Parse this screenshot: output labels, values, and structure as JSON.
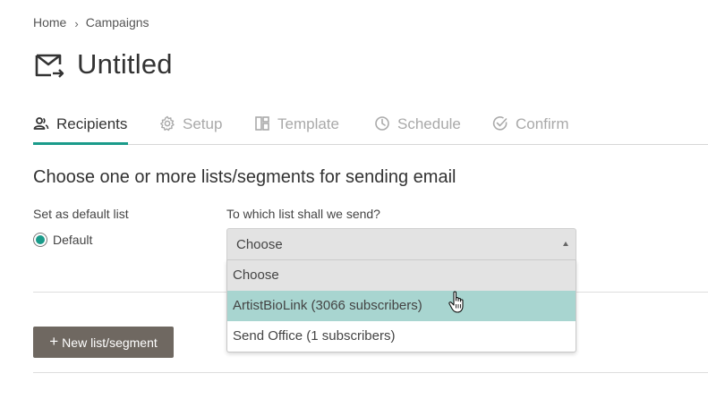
{
  "breadcrumb": {
    "home": "Home",
    "separator": "›",
    "current": "Campaigns"
  },
  "page": {
    "title": "Untitled",
    "title_icon": "mail-send-icon"
  },
  "tabs": [
    {
      "label": "Recipients",
      "icon": "users-icon",
      "active": true
    },
    {
      "label": "Setup",
      "icon": "gear-icon",
      "active": false
    },
    {
      "label": "Template",
      "icon": "layout-icon",
      "active": false
    },
    {
      "label": "Schedule",
      "icon": "clock-icon",
      "active": false
    },
    {
      "label": "Confirm",
      "icon": "check-circle-icon",
      "active": false
    }
  ],
  "section": {
    "heading": "Choose one or more lists/segments for sending email",
    "default_label": "Set as default list",
    "default_radio_label": "Default",
    "list_label": "To which list shall we send?"
  },
  "select": {
    "value": "Choose",
    "options": [
      "Choose",
      "ArtistBioLink (3066 subscribers)",
      "Send Office (1 subscribers)"
    ],
    "hovered_option": "ArtistBioLink (3066 subscribers)"
  },
  "button": {
    "new_list": "New list/segment",
    "plus": "+"
  },
  "colors": {
    "accent": "#1a9b8a",
    "button_bg": "#6f6861",
    "hover_option": "#a8d5d0"
  }
}
